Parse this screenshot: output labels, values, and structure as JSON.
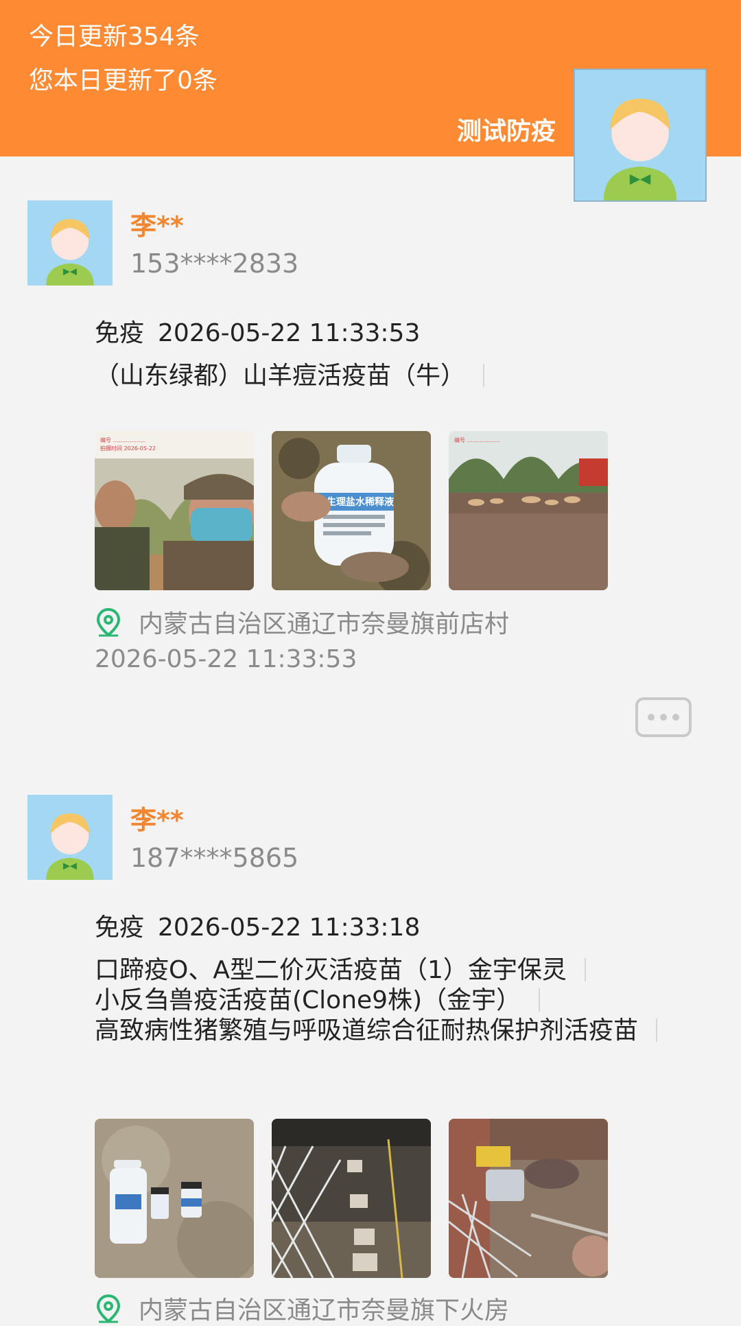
{
  "header": {
    "today_updates": "今日更新354条",
    "your_updates": "您本日更新了0条",
    "team_name": "测试防疫"
  },
  "posts": [
    {
      "name": "李**",
      "phone": "153****2833",
      "action": "免疫",
      "datetime": "2026-05-22 11:33:53",
      "vaccines": [
        "（山东绿都）山羊痘活疫苗（牛）"
      ],
      "location": "内蒙古自治区通辽市奈曼旗前店村",
      "location_time": "2026-05-22 11:33:53",
      "photos": [
        "selfie-two-men-photo",
        "saline-bottle-photo",
        "sheep-field-photo"
      ]
    },
    {
      "name": "李**",
      "phone": "187****5865",
      "action": "免疫",
      "datetime": "2026-05-22 11:33:18",
      "vaccines": [
        "口蹄疫O、A型二价灭活疫苗（1）金宇保灵",
        "小反刍兽疫活疫苗(Clone9株)（金宇）",
        "高致病性猪繁殖与呼吸道综合征耐热保护剂活疫苗"
      ],
      "location": "内蒙古自治区通辽市奈曼旗下火房",
      "photos": [
        "vaccine-bottles-photo",
        "goat-pen-photo",
        "pig-yard-photo"
      ]
    }
  ],
  "colors": {
    "header_bg": "#fe8a33",
    "name": "#f2852f",
    "muted": "#8a8a8a",
    "pin": "#2bb673"
  }
}
